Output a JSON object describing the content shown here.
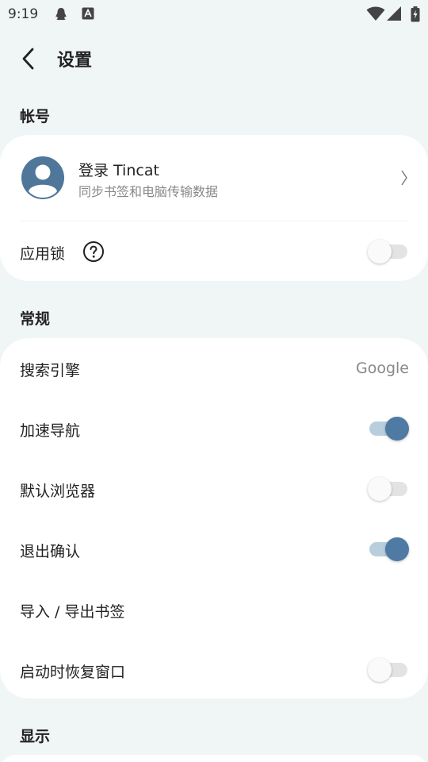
{
  "status_bar": {
    "time": "9:19",
    "left_icons": [
      "qq-penguin-icon",
      "a-notification-icon"
    ],
    "right_icons": [
      "wifi-icon",
      "cell-signal-icon",
      "battery-charging-icon"
    ]
  },
  "appbar": {
    "back_icon": "chevron-left-icon",
    "title": "设置"
  },
  "sections": {
    "account": {
      "header": "帐号",
      "login_title": "登录 Tincat",
      "login_subtitle": "同步书签和电脑传输数据",
      "app_lock_label": "应用锁",
      "app_lock_enabled": false
    },
    "general": {
      "header": "常规",
      "search_engine_label": "搜索引擎",
      "search_engine_value": "Google",
      "accelerated_nav_label": "加速导航",
      "accelerated_nav_enabled": true,
      "default_browser_label": "默认浏览器",
      "default_browser_enabled": false,
      "exit_confirm_label": "退出确认",
      "exit_confirm_enabled": true,
      "import_export_label": "导入 / 导出书签",
      "restore_windows_label": "启动时恢复窗口",
      "restore_windows_enabled": false
    },
    "display": {
      "header": "显示"
    }
  },
  "colors": {
    "background": "#f0f5f6",
    "card": "#ffffff",
    "accent": "#4f7aa3",
    "avatar": "#4f7799"
  }
}
